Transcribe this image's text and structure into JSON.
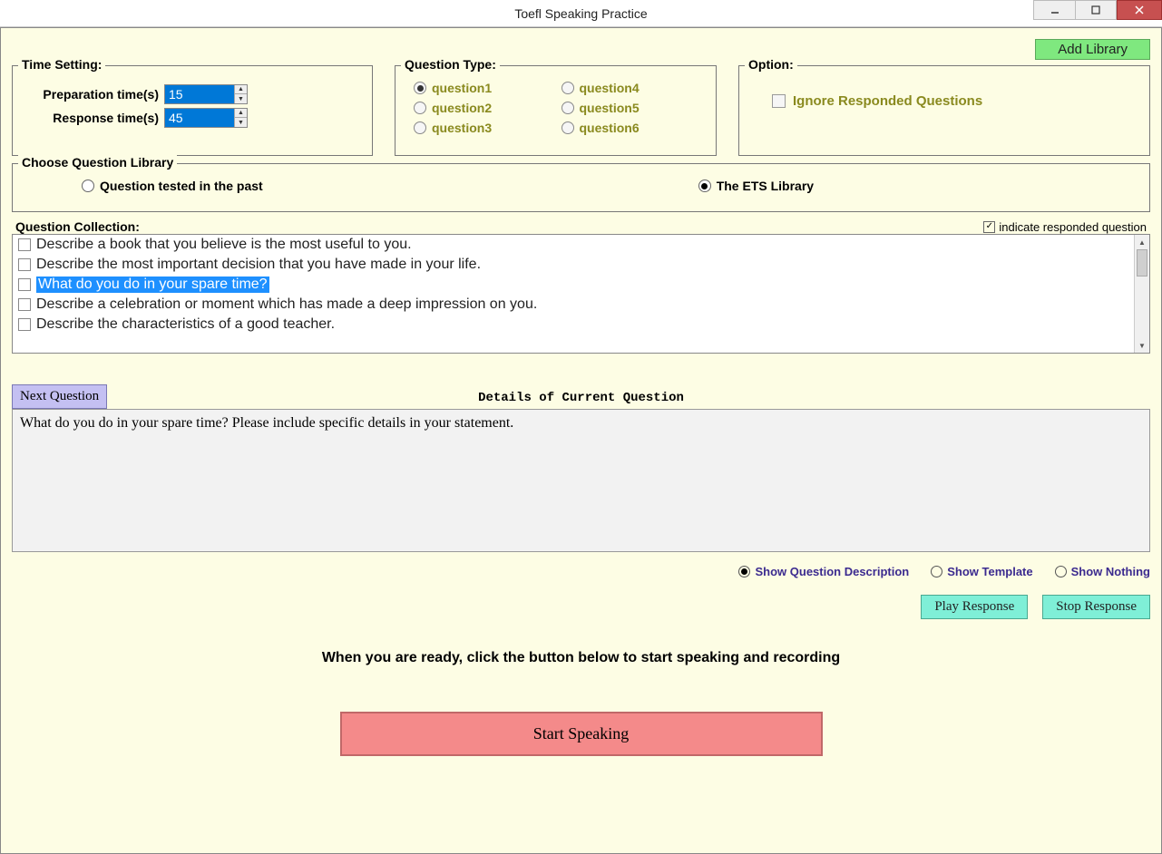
{
  "window": {
    "title": "Toefl Speaking Practice"
  },
  "buttons": {
    "add_library": "Add Library",
    "next_question": "Next Question",
    "play_response": "Play Response",
    "stop_response": "Stop Response",
    "start_speaking": "Start Speaking"
  },
  "time_setting": {
    "legend": "Time Setting:",
    "prep_label": "Preparation time(s)",
    "prep_value": "15",
    "resp_label": "Response time(s)",
    "resp_value": "45"
  },
  "question_type": {
    "legend": "Question Type:",
    "options": [
      "question1",
      "question2",
      "question3",
      "question4",
      "question5",
      "question6"
    ],
    "selected": 0
  },
  "option": {
    "legend": "Option:",
    "ignore_label": "Ignore Responded Questions",
    "ignore_checked": false
  },
  "library": {
    "legend": "Choose Question Library",
    "opt1": "Question tested in the past",
    "opt2": "The ETS Library",
    "selected": 1
  },
  "collection": {
    "label": "Question Collection:",
    "indicate_label": "indicate responded question",
    "indicate_checked": true,
    "items": [
      "Describe a book that you believe is the most useful to you.",
      "Describe the most important decision that you have made in your life.",
      "What do you do in your spare time?",
      "Describe a celebration or moment which has made a deep impression on you.",
      "Describe the characteristics of a good teacher."
    ],
    "selected_index": 2
  },
  "details": {
    "title": "Details of Current Question",
    "text": "What do you do in your spare time? Please include specific details in your statement."
  },
  "show": {
    "opt1": "Show Question Description",
    "opt2": "Show Template",
    "opt3": "Show Nothing",
    "selected": 0
  },
  "ready_text": "When you are ready, click the button below to start speaking and recording"
}
